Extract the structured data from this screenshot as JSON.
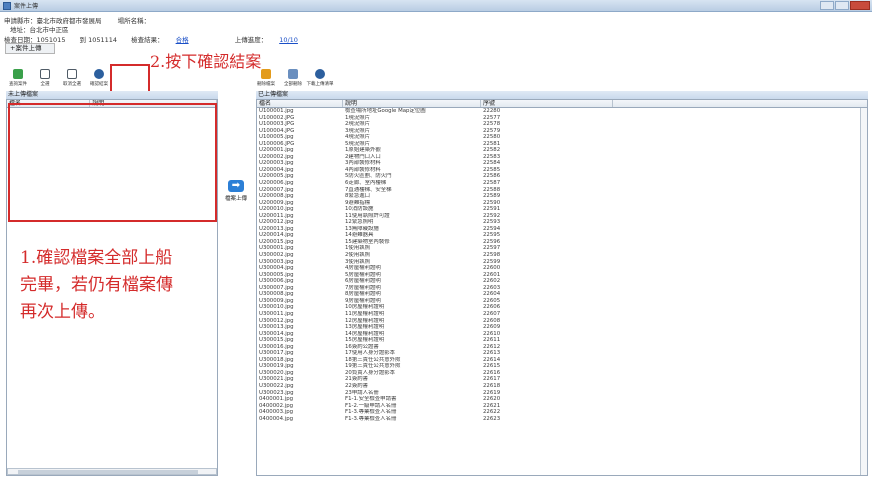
{
  "window": {
    "title": "案件上傳"
  },
  "info": {
    "unit_label": "申請縣市：臺北市政府都市發展局",
    "case_name_label": "場所名稱：",
    "address": "地址：台北市中正區",
    "inspect_date": "檢查日期：1051015",
    "to_date": "到 1051114",
    "result_label": "檢查結果：",
    "result_link": "合格",
    "progress_label": "上傳進度：",
    "progress_link": "10/10"
  },
  "upload_tab": "+案件上傳",
  "toolbar_left": [
    {
      "label": "查詢案件",
      "color": "#3aa04a"
    },
    {
      "label": "全選",
      "color": "#4f5b66"
    },
    {
      "label": "取消全選",
      "color": "#4f5b66"
    },
    {
      "label": "確認結案",
      "color": "#2c5f9e"
    }
  ],
  "toolbar_right": [
    {
      "label": "刪除檔案",
      "color": "#e39b1c"
    },
    {
      "label": "全部刪除",
      "color": "#6a8fbf"
    },
    {
      "label": "下載上傳清單",
      "color": "#2c5f9e"
    }
  ],
  "annotations": {
    "step2": "2.按下確認結案",
    "step1_line1": "1.確認檔案全部上船",
    "step1_line2": "完畢，若仍有檔案傳",
    "step1_line3": "再次上傳。"
  },
  "left_pane": {
    "title": "未上傳檔案",
    "columns": [
      "檔名",
      "說明"
    ]
  },
  "upload_button": "檔案上傳",
  "right_pane": {
    "title": "已上傳檔案",
    "columns": [
      "檔名",
      "說明",
      "序號"
    ],
    "rows": [
      [
        "U100001.jpg",
        "檢查場所地址Google Map定位圖",
        "22280"
      ],
      [
        "U100002.JPG",
        "1現況照片",
        "22577"
      ],
      [
        "U100003.JPG",
        "2現況照片",
        "22578"
      ],
      [
        "U100004.JPG",
        "3現況照片",
        "22579"
      ],
      [
        "U100005.jpg",
        "4現況照片",
        "22580"
      ],
      [
        "U100006.JPG",
        "5現況照片",
        "22581"
      ],
      [
        "U200001.jpg",
        "1原始建築外觀",
        "22582"
      ],
      [
        "U200002.jpg",
        "2建物門口入口",
        "22583"
      ],
      [
        "U200003.jpg",
        "3內部裝修材料",
        "22584"
      ],
      [
        "U200004.jpg",
        "4內部裝修材料",
        "22585"
      ],
      [
        "U200005.jpg",
        "5防火區劃、防火門",
        "22586"
      ],
      [
        "U200006.jpg",
        "6走廊、室內樓梯",
        "22587"
      ],
      [
        "U200007.jpg",
        "7直通樓梯、安全梯",
        "22588"
      ],
      [
        "U200008.jpg",
        "8緊急進口",
        "22589"
      ],
      [
        "U200009.jpg",
        "9避難指標",
        "22590"
      ],
      [
        "U200010.jpg",
        "10消防設施",
        "22591"
      ],
      [
        "U200011.jpg",
        "11使用執照許可證",
        "22592"
      ],
      [
        "U200012.jpg",
        "12緊急照明",
        "22593"
      ],
      [
        "U200013.jpg",
        "13無障礙設施",
        "22594"
      ],
      [
        "U200014.jpg",
        "14避難器具",
        "22595"
      ],
      [
        "U200015.jpg",
        "15建築物室內裝修",
        "22596"
      ],
      [
        "U300001.jpg",
        "1使用執照",
        "22597"
      ],
      [
        "U300002.jpg",
        "2使用執照",
        "22598"
      ],
      [
        "U300003.jpg",
        "3使用執照",
        "22599"
      ],
      [
        "U300004.jpg",
        "4房屋權利證明",
        "22600"
      ],
      [
        "U300005.jpg",
        "5房屋權利證明",
        "22601"
      ],
      [
        "U300006.jpg",
        "6房屋權利證明",
        "22602"
      ],
      [
        "U300007.jpg",
        "7房屋權利證明",
        "22603"
      ],
      [
        "U300008.jpg",
        "8房屋權利證明",
        "22604"
      ],
      [
        "U300009.jpg",
        "9房屋權利證明",
        "22605"
      ],
      [
        "U300010.jpg",
        "10房屋權利證明",
        "22606"
      ],
      [
        "U300011.jpg",
        "11房屋權利證明",
        "22607"
      ],
      [
        "U300012.jpg",
        "12房屋權利證明",
        "22608"
      ],
      [
        "U300013.jpg",
        "13房屋權利證明",
        "22609"
      ],
      [
        "U300014.jpg",
        "14房屋權利證明",
        "22610"
      ],
      [
        "U300015.jpg",
        "15房屋權利證明",
        "22611"
      ],
      [
        "U300016.jpg",
        "16簽約公證書",
        "22612"
      ],
      [
        "U300017.jpg",
        "17使用人身分證影本",
        "22613"
      ],
      [
        "U300018.jpg",
        "18第三責任公共意外險",
        "22614"
      ],
      [
        "U300019.jpg",
        "19第三責任公共意外險",
        "22615"
      ],
      [
        "U300020.jpg",
        "20負責人身分證影本",
        "22616"
      ],
      [
        "U300021.jpg",
        "21簽約書",
        "22617"
      ],
      [
        "U300022.jpg",
        "22簽約書",
        "22618"
      ],
      [
        "U300023.jpg",
        "23申請人名冊",
        "22619"
      ],
      [
        "0400001.jpg",
        "F1-1.安全檢查申請書",
        "22620"
      ],
      [
        "0400002.jpg",
        "F1-2.一級申請人名冊",
        "22621"
      ],
      [
        "0400003.jpg",
        "F1-3.專業檢查人名冊",
        "22622"
      ],
      [
        "0400004.jpg",
        "F1-3.專業檢查人名冊",
        "22623"
      ]
    ]
  }
}
